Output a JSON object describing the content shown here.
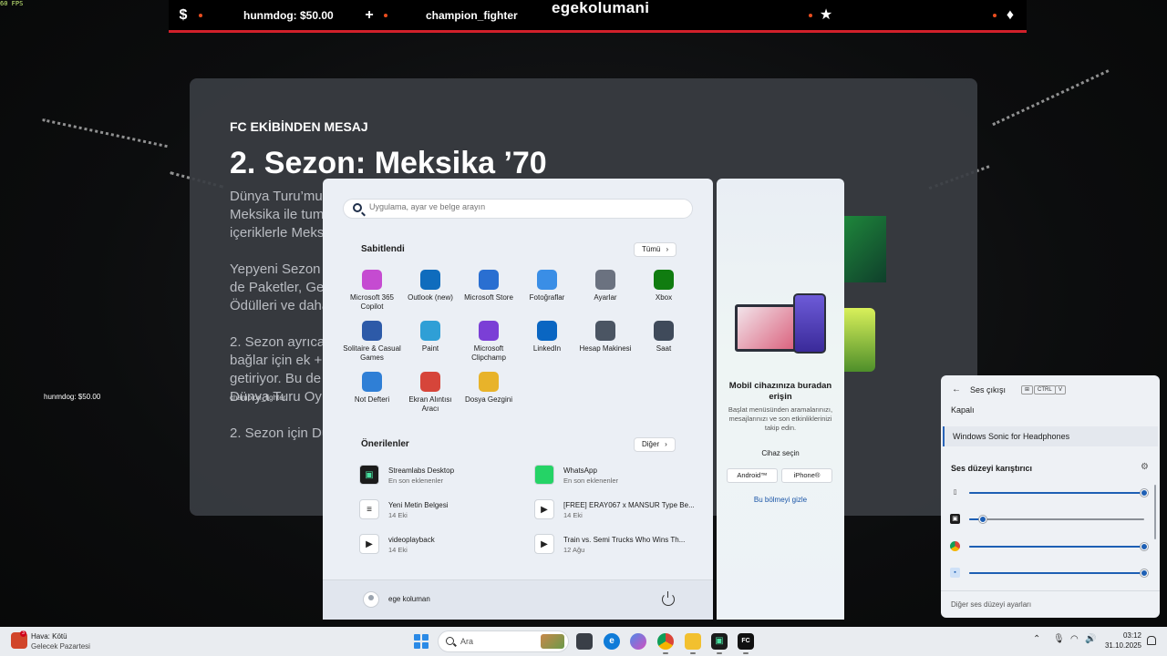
{
  "fps": "60 FPS",
  "overlay": {
    "money_item": "hunmdog: $50.00",
    "champion_item": "champion_fighter",
    "brand": "egekolumani",
    "money_small": "hunmdog: $50.00",
    "champion_small": "champion_fighter"
  },
  "fc_panel": {
    "kicker": "FC EKİBİNDEN MESAJ",
    "title": "2. Sezon: Meksika ’70",
    "para1": "Dünya Turu’mu\nMeksika ile tum\niçeriklerle Meks",
    "para2": "Yepyeni Sezon\nde Paketler, Ge\nÖdülleri ve daha",
    "para3": "2. Sezon ayrıca\nbağlar için ek +\ngetiriyor. Bu de\nDünya Turu Oy",
    "para4": "2. Sezon için Dü"
  },
  "start_menu": {
    "search_placeholder": "Uygulama, ayar ve belge arayın",
    "pinned_title": "Sabitlendi",
    "all_button": "Tümü",
    "pinned_apps": [
      {
        "label": "Microsoft 365 Copilot",
        "icon": "copilot-icon",
        "color": "#c54bd1"
      },
      {
        "label": "Outlook (new)",
        "icon": "outlook-icon",
        "color": "#0f6cbd"
      },
      {
        "label": "Microsoft Store",
        "icon": "store-icon",
        "color": "#2a6fd1"
      },
      {
        "label": "Fotoğraflar",
        "icon": "photos-icon",
        "color": "#3a8ee6"
      },
      {
        "label": "Ayarlar",
        "icon": "settings-gear-icon",
        "color": "#6b7280"
      },
      {
        "label": "Xbox",
        "icon": "xbox-icon",
        "color": "#107c10"
      },
      {
        "label": "Solitaire & Casual Games",
        "icon": "solitaire-icon",
        "color": "#2d5aa8"
      },
      {
        "label": "Paint",
        "icon": "paint-icon",
        "color": "#2f9fd6"
      },
      {
        "label": "Microsoft Clipchamp",
        "icon": "clipchamp-icon",
        "color": "#7b3fd6"
      },
      {
        "label": "LinkedIn",
        "icon": "linkedin-icon",
        "color": "#0a66c2"
      },
      {
        "label": "Hesap Makinesi",
        "icon": "calculator-icon",
        "color": "#4b5563"
      },
      {
        "label": "Saat",
        "icon": "clock-icon",
        "color": "#3f4a5a"
      },
      {
        "label": "Not Defteri",
        "icon": "notepad-icon",
        "color": "#2f7fd6"
      },
      {
        "label": "Ekran Alıntısı Aracı",
        "icon": "snipping-tool-icon",
        "color": "#d6453a"
      },
      {
        "label": "Dosya Gezgini",
        "icon": "file-explorer-icon",
        "color": "#e8b32a"
      }
    ],
    "recommended_title": "Önerilenler",
    "more_button": "Diğer",
    "recommended": [
      {
        "name": "Streamlabs Desktop",
        "sub": "En son eklenenler",
        "icon": "streamlabs-icon",
        "color": "#1b1b1b"
      },
      {
        "name": "WhatsApp",
        "sub": "En son eklenenler",
        "icon": "whatsapp-icon",
        "color": "#25d366"
      },
      {
        "name": "Yeni Metin Belgesi",
        "sub": "14 Eki",
        "icon": "text-document-icon",
        "color": "#ffffff"
      },
      {
        "name": "[FREE] ERAY067 x MANSUR Type Be...",
        "sub": "14 Eki",
        "icon": "video-file-icon",
        "color": "#ffffff"
      },
      {
        "name": "videoplayback",
        "sub": "14 Eki",
        "icon": "video-file-icon",
        "color": "#ffffff"
      },
      {
        "name": "Train vs. Semi Trucks  Who Wins Th...",
        "sub": "12 Ağu",
        "icon": "video-file-icon",
        "color": "#ffffff"
      }
    ],
    "user_name": "ege koluman"
  },
  "phone_panel": {
    "title": "Mobil cihazınıza buradan erişin",
    "description": "Başlat menüsünden aramalarınızı, mesajlarınızı ve son etkinliklerinizi takip edin.",
    "device_label": "Cihaz seçin",
    "android_button": "Android™",
    "iphone_button": "iPhone®",
    "hide_link": "Bu bölmeyi gizle"
  },
  "volume_flyout": {
    "title": "Ses çıkışı",
    "key1": "⊞",
    "key2": "CTRL",
    "key3": "V",
    "option_off": "Kapalı",
    "option_sonic": "Windows Sonic for Headphones",
    "mixer_title": "Ses düzeyi karıştırıcı",
    "channels": [
      {
        "icon": "system-sounds-icon",
        "level": 100
      },
      {
        "icon": "streamlabs-app-icon",
        "level": 8
      },
      {
        "icon": "chrome-app-icon",
        "level": 100
      },
      {
        "icon": "generic-app-icon",
        "level": 100
      }
    ],
    "footer": "Diğer ses düzeyi ayarları"
  },
  "taskbar": {
    "weather_title": "Hava: Kötü",
    "weather_sub": "Gelecek Pazartesi",
    "weather_badge": "3",
    "search_text": "Ara",
    "time": "03:12",
    "date": "31.10.2025"
  }
}
